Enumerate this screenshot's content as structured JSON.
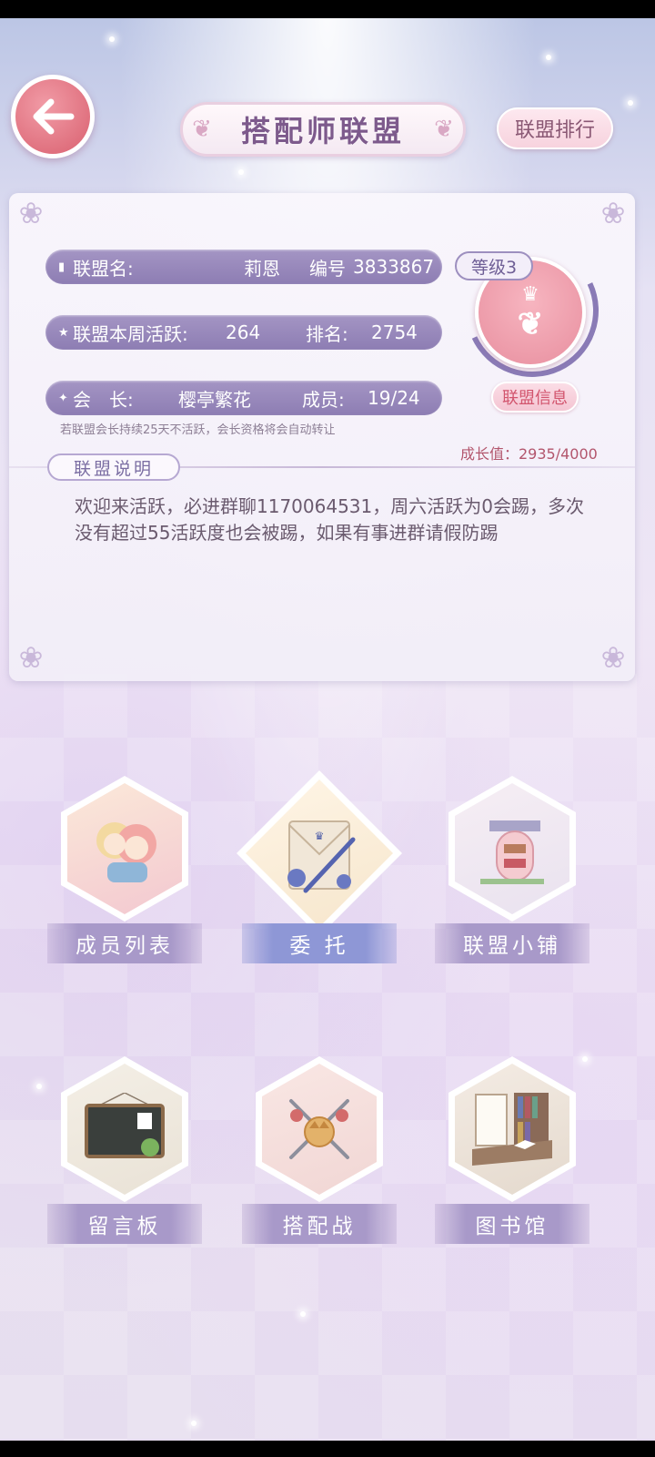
{
  "header": {
    "title": "搭配师联盟",
    "rank_button": "联盟排行"
  },
  "alliance": {
    "name_label": "联盟名:",
    "name_value": "莉恩",
    "id_label": "编号",
    "id_value": "3833867",
    "activity_label": "联盟本周活跃:",
    "activity_value": "264",
    "rank_label": "排名:",
    "rank_value": "2754",
    "leader_label": "会　长:",
    "leader_value": "樱亭繁花",
    "members_label": "成员:",
    "members_value": "19/24",
    "level": "等级3",
    "info_button": "联盟信息",
    "notice": "若联盟会长持续25天不活跃，会长资格将会自动转让",
    "growth": "成长值：2935/4000",
    "description_label": "联盟说明",
    "description": "欢迎来活跃，必进群聊1170064531，周六活跃为0会踢，多次没有超过55活跃度也会被踢，如果有事进群请假防踢"
  },
  "menu": [
    {
      "label": "成员列表",
      "icon": "members-icon"
    },
    {
      "label": "委 托",
      "icon": "commission-icon"
    },
    {
      "label": "联盟小铺",
      "icon": "shop-icon"
    },
    {
      "label": "留言板",
      "icon": "message-board-icon"
    },
    {
      "label": "搭配战",
      "icon": "styling-battle-icon"
    },
    {
      "label": "图书馆",
      "icon": "library-icon"
    }
  ],
  "colors": {
    "accent_purple": "#8d7db3",
    "accent_pink": "#e88f9f",
    "title_text": "#7d5a8c"
  }
}
